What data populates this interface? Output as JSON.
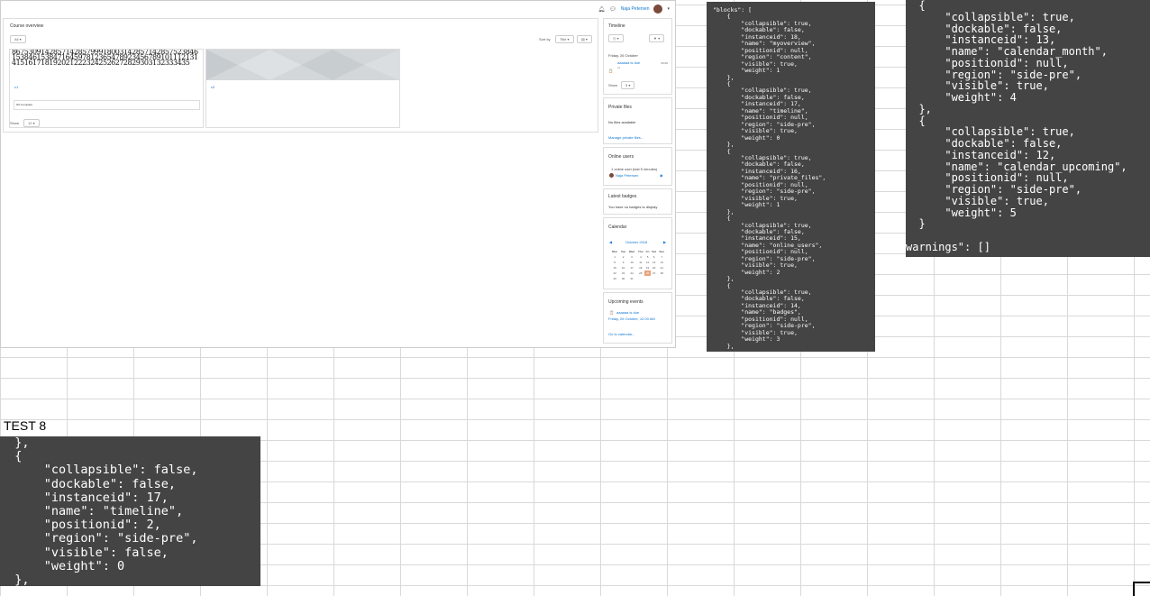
{
  "moodle": {
    "user_name": "Naja Petersen",
    "course_overview": {
      "title": "Course overview",
      "filter": "All",
      "sort_label": "Sort by",
      "sort_value": "Title",
      "courses": [
        {
          "name": "c1",
          "progress": "0% Complete"
        },
        {
          "name": "c2"
        }
      ],
      "show_label": "Show",
      "show_value": "12"
    },
    "timeline": {
      "title": "Timeline",
      "date": "Friday, 26 October",
      "event": "aaaaaa is due",
      "event_sub": "c1",
      "time": "00:00",
      "show_label": "Show",
      "show_value": "5"
    },
    "private_files": {
      "title": "Private files",
      "empty": "No files available",
      "manage": "Manage private files..."
    },
    "online_users": {
      "title": "Online users",
      "summary": "1 online user (last 5 minutes)",
      "user": "Naja Petersen"
    },
    "latest_badges": {
      "title": "Latest badges",
      "empty": "You have no badges to display"
    },
    "calendar": {
      "title": "Calendar",
      "month": "October 2018",
      "days": [
        "Mon",
        "Tue",
        "Wed",
        "Thu",
        "Fri",
        "Sat",
        "Sun"
      ],
      "weeks": [
        [
          "1",
          "2",
          "3",
          "4",
          "5",
          "6",
          "7"
        ],
        [
          "8",
          "9",
          "10",
          "11",
          "12",
          "13",
          "14"
        ],
        [
          "15",
          "16",
          "17",
          "18",
          "19",
          "20",
          "21"
        ],
        [
          "22",
          "23",
          "24",
          "25",
          "26",
          "27",
          "28"
        ],
        [
          "29",
          "30",
          "31",
          "",
          "",
          "",
          ""
        ]
      ],
      "today": "26"
    },
    "upcoming": {
      "title": "Upcoming events",
      "event": "aaaaaa is due",
      "when": "Friday, 26 October, 12:00 AM",
      "goto": "Go to calendar..."
    },
    "course_image_digits": "8675309142857142857999180031428571428575238461538461538471645978123654789234567891011121314151617181920212223242526272829303132333435"
  },
  "json_panel_1": "\"blocks\": [\n    {\n        \"collapsible\": true,\n        \"dockable\": false,\n        \"instanceid\": 18,\n        \"name\": \"myoverview\",\n        \"positionid\": null,\n        \"region\": \"content\",\n        \"visible\": true,\n        \"weight\": 1\n    },\n    {\n        \"collapsible\": true,\n        \"dockable\": false,\n        \"instanceid\": 17,\n        \"name\": \"timeline\",\n        \"positionid\": null,\n        \"region\": \"side-pre\",\n        \"visible\": true,\n        \"weight\": 0\n    },\n    {\n        \"collapsible\": true,\n        \"dockable\": false,\n        \"instanceid\": 16,\n        \"name\": \"private_files\",\n        \"positionid\": null,\n        \"region\": \"side-pre\",\n        \"visible\": true,\n        \"weight\": 1\n    },\n    {\n        \"collapsible\": true,\n        \"dockable\": false,\n        \"instanceid\": 15,\n        \"name\": \"online_users\",\n        \"positionid\": null,\n        \"region\": \"side-pre\",\n        \"visible\": true,\n        \"weight\": 2\n    },\n    {\n        \"collapsible\": true,\n        \"dockable\": false,\n        \"instanceid\": 14,\n        \"name\": \"badges\",\n        \"positionid\": null,\n        \"region\": \"side-pre\",\n        \"visible\": true,\n        \"weight\": 3\n    },",
  "json_panel_2": "  {\n      \"collapsible\": true,\n      \"dockable\": false,\n      \"instanceid\": 13,\n      \"name\": \"calendar_month\",\n      \"positionid\": null,\n      \"region\": \"side-pre\",\n      \"visible\": true,\n      \"weight\": 4\n  },\n  {\n      \"collapsible\": true,\n      \"dockable\": false,\n      \"instanceid\": 12,\n      \"name\": \"calendar_upcoming\",\n      \"positionid\": null,\n      \"region\": \"side-pre\",\n      \"visible\": true,\n      \"weight\": 5\n  }\n\nwarnings\": []",
  "test_label": "TEST 8",
  "json_panel_3": "  },\n  {\n      \"collapsible\": false,\n      \"dockable\": false,\n      \"instanceid\": 17,\n      \"name\": \"timeline\",\n      \"positionid\": 2,\n      \"region\": \"side-pre\",\n      \"visible\": false,\n      \"weight\": 0\n  },\n  {"
}
